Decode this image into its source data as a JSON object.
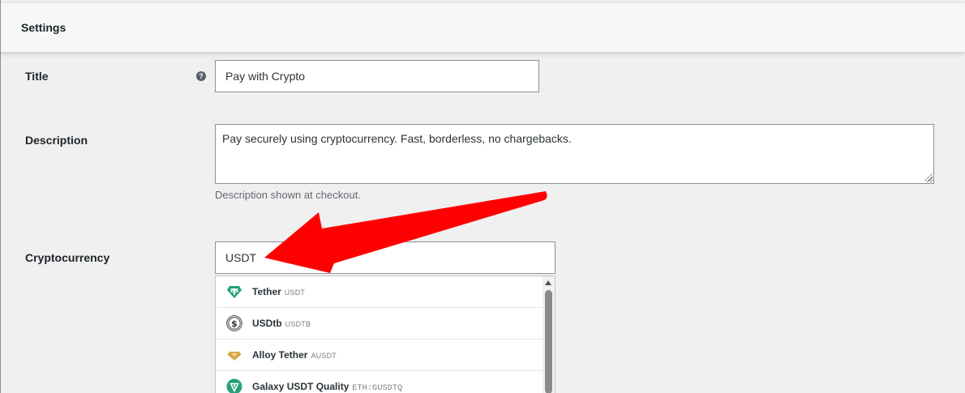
{
  "header": {
    "title": "Settings"
  },
  "fields": {
    "title": {
      "label": "Title",
      "help_icon": "question-circle-icon",
      "value": "Pay with Crypto"
    },
    "description": {
      "label": "Description",
      "value": "Pay securely using cryptocurrency. Fast, borderless, no chargebacks.",
      "helper": "Description shown at checkout."
    },
    "cryptocurrency": {
      "label": "Cryptocurrency",
      "value": "USDT",
      "options": [
        {
          "name": "Tether",
          "symbol": "USDT",
          "icon": "tether-icon",
          "color": "#26a17b"
        },
        {
          "name": "USDtb",
          "symbol": "USDTB",
          "icon": "usdtb-icon",
          "color": "#333333"
        },
        {
          "name": "Alloy Tether",
          "symbol": "AUSDT",
          "icon": "alloy-tether-icon",
          "color": "#d4a94a"
        },
        {
          "name": "Galaxy USDT Quality",
          "symbol": "ETH:GUSDTQ",
          "icon": "galaxy-usdt-icon",
          "color": "#26a17b"
        }
      ]
    }
  },
  "colors": {
    "arrow": "#ff0000",
    "accent": "#26a17b"
  }
}
